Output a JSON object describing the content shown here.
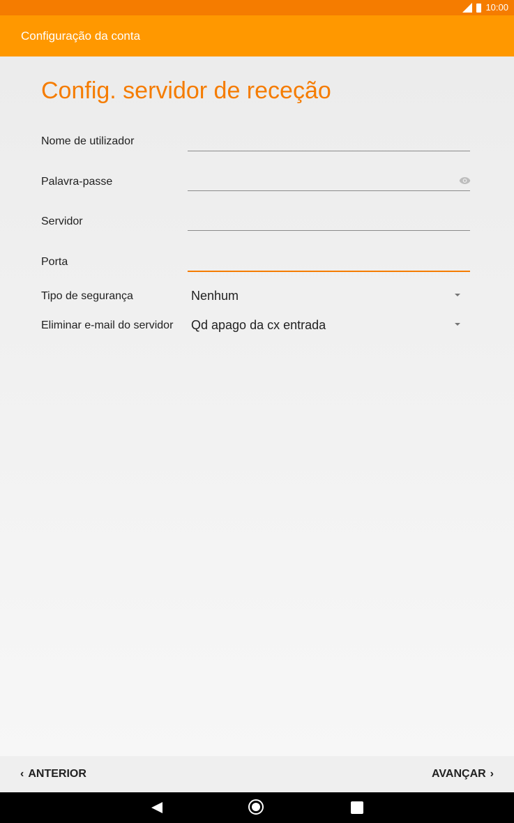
{
  "status_bar": {
    "time": "10:00"
  },
  "app_bar": {
    "title": "Configuração da conta"
  },
  "page": {
    "title": "Config. servidor de receção"
  },
  "fields": {
    "username": {
      "label": "Nome de utilizador",
      "value": ""
    },
    "password": {
      "label": "Palavra-passe",
      "value": ""
    },
    "server": {
      "label": "Servidor",
      "value": ""
    },
    "port": {
      "label": "Porta",
      "value": ""
    }
  },
  "selects": {
    "security_type": {
      "label": "Tipo de segurança",
      "value": "Nenhum"
    },
    "delete_email": {
      "label": "Eliminar e-mail do servidor",
      "value": "Qd apago da cx entrada"
    }
  },
  "actions": {
    "previous_label": "ANTERIOR",
    "next_label": "AVANÇAR"
  },
  "colors": {
    "accent": "#f57c00",
    "app_bar": "#ff9800"
  }
}
